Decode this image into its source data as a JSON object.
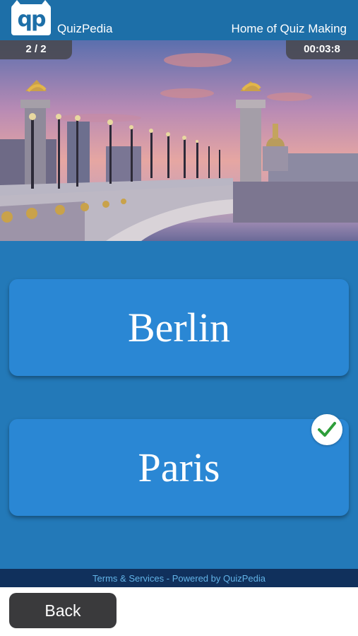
{
  "header": {
    "logo_text": "qp",
    "app_name": "QuizPedia",
    "tagline": "Home of Quiz Making"
  },
  "quiz": {
    "counter": "2 / 2",
    "timer": "00:03:8",
    "answers": [
      {
        "label": "Berlin",
        "selected": false
      },
      {
        "label": "Paris",
        "selected": true
      }
    ]
  },
  "footer": {
    "text": "Terms & Services - Powered by QuizPedia",
    "back_label": "Back"
  },
  "colors": {
    "background": "#2379b8",
    "header": "#1d6fa8",
    "answer_button": "#2a87d4",
    "footer_bar": "#10305c",
    "check": "#2e9e3a"
  },
  "icons": {
    "logo": "quizpedia-cat-logo-icon",
    "correct": "check-icon"
  }
}
